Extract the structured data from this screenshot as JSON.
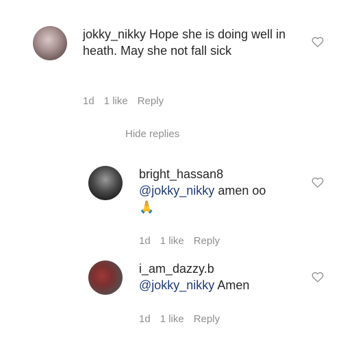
{
  "comments": [
    {
      "username": "jokky_nikky",
      "text": "Hope she is doing well in heath. May she not fall sick",
      "time": "1d",
      "likes": "1 like",
      "reply": "Reply"
    }
  ],
  "hide_replies": "Hide replies",
  "replies": [
    {
      "username": "bright_hassan8",
      "mention": "@jokky_nikky",
      "text": "amen oo",
      "emoji": "🙏",
      "time": "1d",
      "likes": "1 like",
      "reply": "Reply"
    },
    {
      "username": "i_am_dazzy.b",
      "mention": "@jokky_nikky",
      "text": "Amen",
      "time": "1d",
      "likes": "1 like",
      "reply": "Reply"
    }
  ]
}
